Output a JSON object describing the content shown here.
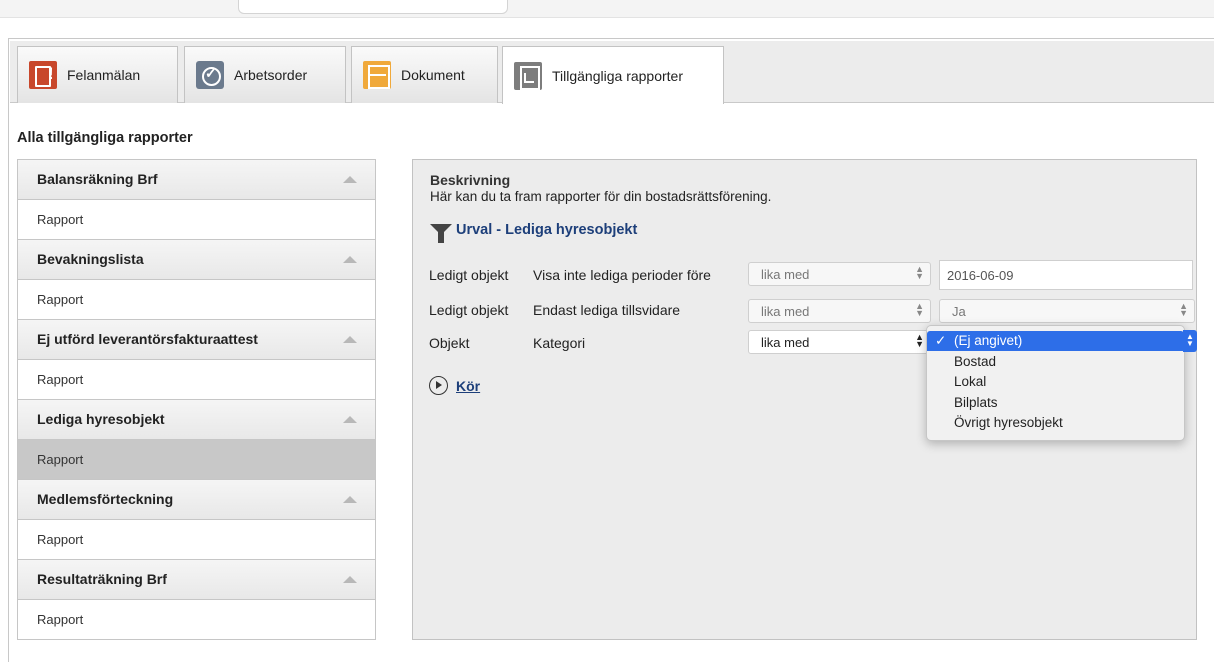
{
  "tabs": [
    {
      "label": "Felanmälan",
      "icon": "report-issue-icon",
      "color": "#c8472b"
    },
    {
      "label": "Arbetsorder",
      "icon": "checkmark-clock-icon",
      "color": "#6b7a8d"
    },
    {
      "label": "Dokument",
      "icon": "cabinet-icon",
      "color": "#f0a93b"
    },
    {
      "label": "Tillgängliga rapporter",
      "icon": "chart-report-icon",
      "color": "#7d7d7d",
      "active": true
    }
  ],
  "section_title": "Alla tillgängliga rapporter",
  "reports": [
    {
      "title": "Balansräkning Brf",
      "link": "Rapport"
    },
    {
      "title": "Bevakningslista",
      "link": "Rapport"
    },
    {
      "title": "Ej utförd leverantörsfakturaattest",
      "link": "Rapport"
    },
    {
      "title": "Lediga hyresobjekt",
      "link": "Rapport",
      "selected": true
    },
    {
      "title": "Medlemsförteckning",
      "link": "Rapport"
    },
    {
      "title": "Resultaträkning Brf",
      "link": "Rapport"
    }
  ],
  "panel": {
    "description_title": "Beskrivning",
    "description_text": "Här kan du ta fram rapporter för din bostadsrättsförening.",
    "urval_title": "Urval - Lediga hyresobjekt",
    "criteria": [
      {
        "object": "Ledigt objekt",
        "field": "Visa inte lediga perioder före",
        "operator": "lika med",
        "value": "2016-06-09"
      },
      {
        "object": "Ledigt objekt",
        "field": "Endast lediga tillsvidare",
        "operator": "lika med",
        "value": "Ja"
      },
      {
        "object": "Objekt",
        "field": "Kategori",
        "operator": "lika med",
        "value": "(Ej angivet)"
      }
    ],
    "run_label": "Kör"
  },
  "dropdown": {
    "check": "✓",
    "options": [
      "(Ej angivet)",
      "Bostad",
      "Lokal",
      "Bilplats",
      "Övrigt hyresobjekt"
    ],
    "selected": "(Ej angivet)"
  }
}
